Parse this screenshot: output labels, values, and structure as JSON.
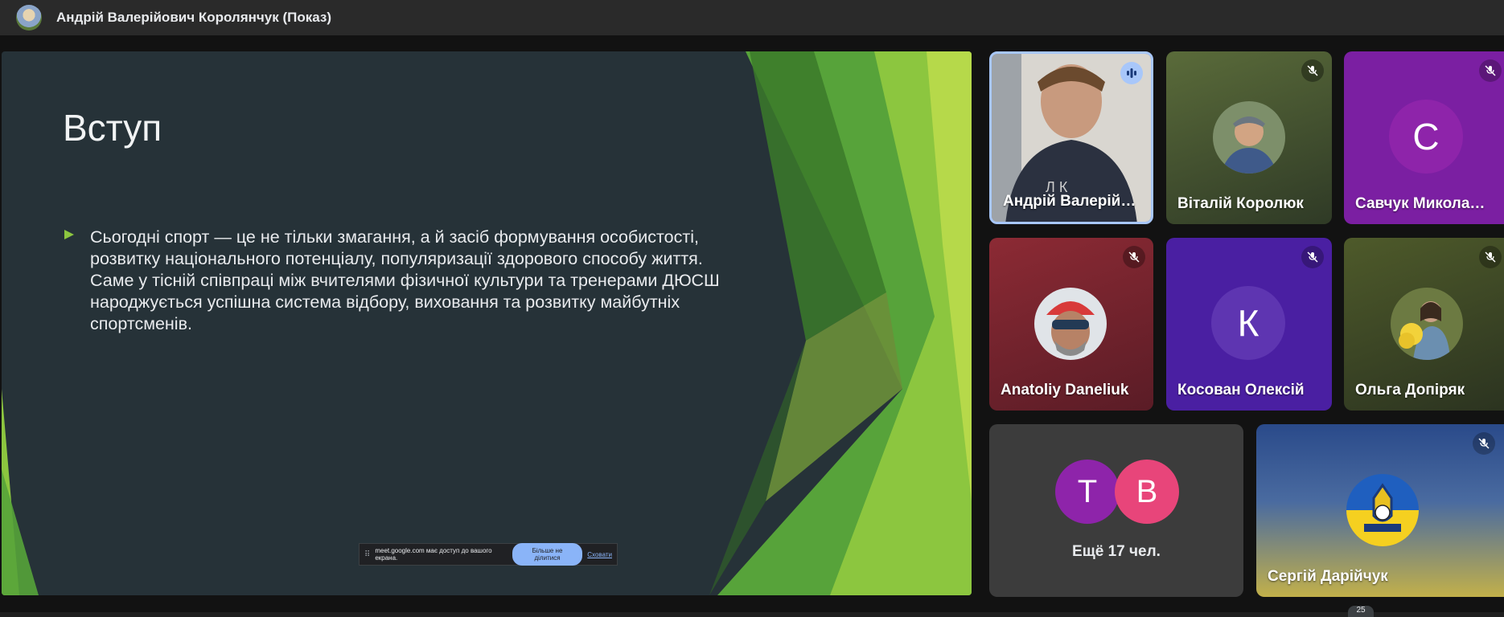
{
  "header": {
    "presenter_title": "Андрій Валерійович Королянчук (Показ)"
  },
  "slide": {
    "title": "Вступ",
    "body": "Сьогодні спорт — це не тільки змагання, а й засіб формування особистості, розвитку національного потенціалу, популяризації здорового способу життя. Саме у тісній співпраці між вчителями фізичної культури та тренерами ДЮСШ народжується успішна система відбору, виховання та розвитку майбутніх спортсменів.",
    "accent_color": "#8cc63f"
  },
  "share_bar": {
    "message": "meet.google.com має доступ до вашого екрана.",
    "stop_label": "Більше не ділитися",
    "hide_label": "Сховати"
  },
  "participants": [
    {
      "name": "Андрій Валерій…",
      "mic": "speaking",
      "avatar": "video"
    },
    {
      "name": "Віталій Королюк",
      "mic": "muted",
      "avatar": "photo"
    },
    {
      "name": "Савчук Микола…",
      "mic": "muted",
      "avatar": "letter",
      "letter": "С",
      "color": "#8e24aa"
    },
    {
      "name": "Anatoliy Daneliuk",
      "mic": "muted",
      "avatar": "photo"
    },
    {
      "name": "Косован Олексій",
      "mic": "muted",
      "avatar": "letter",
      "letter": "К",
      "color": "#5e35b1"
    },
    {
      "name": "Ольга Допіряк",
      "mic": "muted",
      "avatar": "photo"
    },
    {
      "name": "Сергій Дарійчук",
      "mic": "muted",
      "avatar": "photo"
    }
  ],
  "more_tile": {
    "avatars": [
      {
        "letter": "T",
        "color": "#8e24aa"
      },
      {
        "letter": "B",
        "color": "#e8457a"
      }
    ],
    "label": "Ещё 17 чел."
  },
  "people_count": "25",
  "icons": {
    "mic_off": "mic-off-icon",
    "speaking": "audio-wave-icon"
  }
}
